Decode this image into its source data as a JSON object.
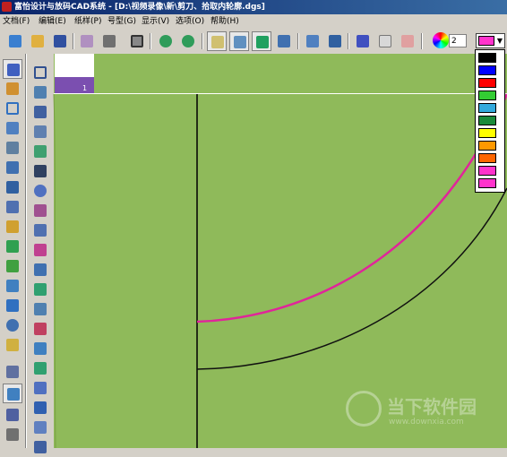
{
  "window": {
    "title": "富怡设计与放码CAD系统 - [D:\\视频录像\\新\\剪刀、拾取内轮廓.dgs]"
  },
  "menu": [
    {
      "label": "文档(F)"
    },
    {
      "label": "编辑(E)"
    },
    {
      "label": "纸样(P)"
    },
    {
      "label": "号型(G)"
    },
    {
      "label": "显示(V)"
    },
    {
      "label": "选项(O)"
    },
    {
      "label": "帮助(H)"
    }
  ],
  "toolbar": {
    "line_width_value": "2",
    "current_color": "#ff33cc",
    "icons": [
      "open-file-icon",
      "folder-icon",
      "save-icon",
      "eraser-icon",
      "camera-icon",
      "frame-icon",
      "undo-icon",
      "redo-icon",
      "point-icon",
      "grid-icon",
      "shape-icon",
      "layers-icon",
      "brush-icon",
      "stamp-icon",
      "chart-icon",
      "envelope-icon",
      "envelope2-icon"
    ]
  },
  "left_tools": {
    "col1": [
      "pointer-icon",
      "pen-icon",
      "rectangle-icon",
      "angle-icon",
      "cut-icon",
      "measure-icon",
      "compass-icon",
      "knife-icon",
      "pencil-icon",
      "bucket-icon",
      "bottle-icon",
      "flag-icon",
      "shape-icon",
      "spiral-icon",
      "ruler-icon",
      "scissors-icon",
      "wave-icon",
      "list-icon",
      "text-icon"
    ],
    "col2": [
      "frame-icon",
      "pocket-icon",
      "dart-icon",
      "boot-icon",
      "tray-icon",
      "width-icon",
      "circle-icon",
      "grid-icon",
      "tag-icon",
      "layer-icon",
      "cut2-icon",
      "tack-icon",
      "gear-icon",
      "drop-icon",
      "arrow-icon",
      "fold-icon",
      "swatch-icon",
      "pin-icon",
      "pattern-icon",
      "bar-icon"
    ]
  },
  "pattern_tab": {
    "number": "1"
  },
  "color_dropdown": {
    "options": [
      "#000000",
      "#0000ff",
      "#ff0000",
      "#33cc33",
      "#33aadd",
      "#1a8a3a",
      "#ffff00",
      "#ff9900",
      "#ff6600",
      "#ff33cc",
      "#ff33cc"
    ]
  },
  "watermark": {
    "text": "当下软件园",
    "url": "www.downxia.com"
  }
}
